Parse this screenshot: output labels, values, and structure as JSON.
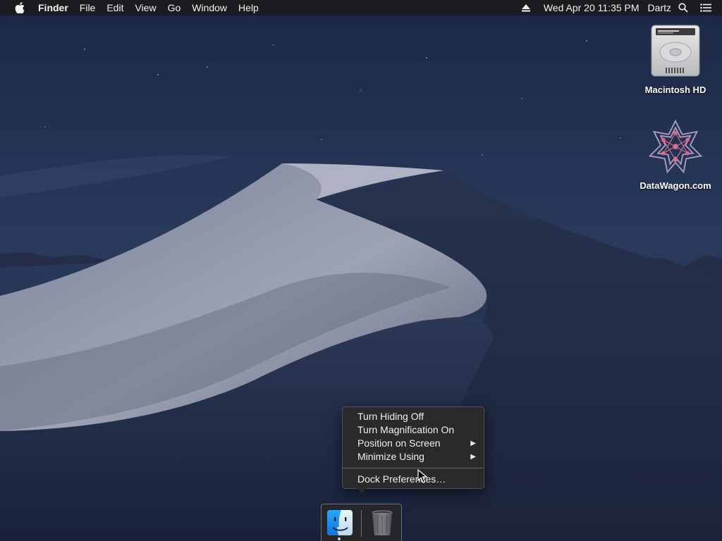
{
  "menubar": {
    "apple_icon": "apple-icon",
    "app_name": "Finder",
    "menus": [
      "File",
      "Edit",
      "View",
      "Go",
      "Window",
      "Help"
    ],
    "datetime": "Wed Apr 20  11:35 PM",
    "user": "Dartz",
    "status_icons": [
      "eject-icon",
      "search-icon",
      "notification-center-icon"
    ]
  },
  "desktop": {
    "icons": [
      {
        "label": "Macintosh HD",
        "icon": "hard-drive-icon"
      },
      {
        "label": "DataWagon.com",
        "icon": "network-volume-icon"
      }
    ]
  },
  "context_menu": {
    "items": [
      {
        "label": "Turn Hiding Off",
        "submenu": false
      },
      {
        "label": "Turn Magnification On",
        "submenu": false
      },
      {
        "label": "Position on Screen",
        "submenu": true
      },
      {
        "label": "Minimize Using",
        "submenu": true
      }
    ],
    "footer_item": "Dock Preferences…",
    "submenu_arrow": "▶"
  },
  "dock": {
    "apps": [
      {
        "name": "Finder",
        "icon": "finder-icon",
        "running": true
      },
      {
        "name": "Trash",
        "icon": "trash-icon",
        "running": false
      }
    ]
  },
  "colors": {
    "menubar_bg": "#1c1c1e",
    "sky": "#1d2a47",
    "dune_light": "#8d93a8",
    "menu_bg": "#2a2a2c"
  }
}
